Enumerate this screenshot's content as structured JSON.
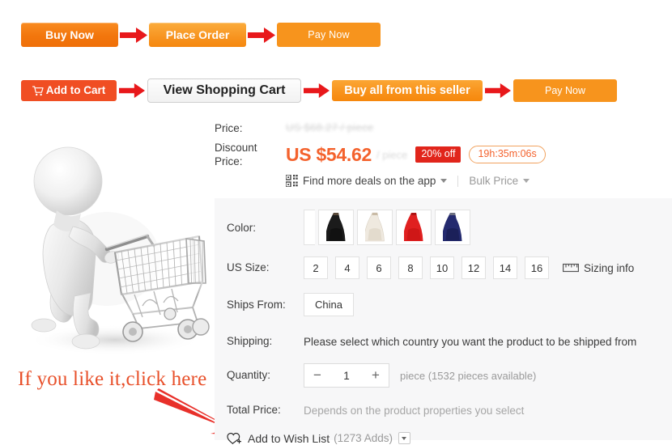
{
  "flow_row_1": {
    "steps": [
      {
        "label": "Buy Now",
        "style": "orange"
      },
      {
        "label": "Place Order",
        "style": "orange-light"
      },
      {
        "label": "Pay Now",
        "style": "orange-flat"
      }
    ],
    "arrow_icon": "right-arrow-icon"
  },
  "flow_row_2": {
    "steps": [
      {
        "label": "Add to Cart",
        "style": "red",
        "icon": "shopping-cart-icon"
      },
      {
        "label": "View Shopping Cart",
        "style": "white"
      },
      {
        "label": "Buy all from this seller",
        "style": "orange-light"
      },
      {
        "label": "Pay Now",
        "style": "orange-flat"
      }
    ],
    "arrow_icon": "right-arrow-icon"
  },
  "hero": {
    "alt": "3d-character-pushing-shopping-cart"
  },
  "annotation": {
    "text": "If you like it,click here",
    "color": "#e8502a",
    "arrow_icon": "red-pointer-arrow-icon"
  },
  "price": {
    "label": "Price:",
    "original": "US $68.27 / piece",
    "discount_label": "Discount Price:",
    "discount_label_line1": "Discount",
    "discount_label_line2": "Price:",
    "discount_value": "US $54.62",
    "unit": "/ piece",
    "off_badge": "20% off",
    "off_badge_color": "#e1251b",
    "timer": "19h:35m:06s",
    "timer_color": "#f4622d",
    "app_deal": "Find more deals on the app",
    "app_icon": "qr-code-icon",
    "bulk_price": "Bulk Price"
  },
  "options": {
    "color": {
      "label": "Color:",
      "swatches": [
        {
          "name": "partial-swatch",
          "color": "#ffffff",
          "partial": true
        },
        {
          "name": "black-dress",
          "color": "#1b1b1b"
        },
        {
          "name": "white-dress",
          "color": "#efe9df"
        },
        {
          "name": "red-dress",
          "color": "#e02020"
        },
        {
          "name": "navy-dress",
          "color": "#242a6e"
        }
      ]
    },
    "size": {
      "label": "US Size:",
      "values": [
        "2",
        "4",
        "6",
        "8",
        "10",
        "12",
        "14",
        "16"
      ],
      "sizing_info": "Sizing info",
      "sizing_icon": "ruler-icon"
    },
    "ships_from": {
      "label": "Ships From:",
      "value": "China"
    },
    "shipping": {
      "label": "Shipping:",
      "message": "Please select which country you want the product to be shipped from"
    },
    "quantity": {
      "label": "Quantity:",
      "minus": "−",
      "plus": "+",
      "value": "1",
      "note": "piece (1532 pieces available)"
    },
    "total_price": {
      "label": "Total Price:",
      "message": "Depends on the product properties you select"
    },
    "wishlist": {
      "icon": "heart-plus-icon",
      "label": "Add to Wish List",
      "count": "(1273 Adds)",
      "dropdown_icon": "chevron-down-icon"
    }
  }
}
